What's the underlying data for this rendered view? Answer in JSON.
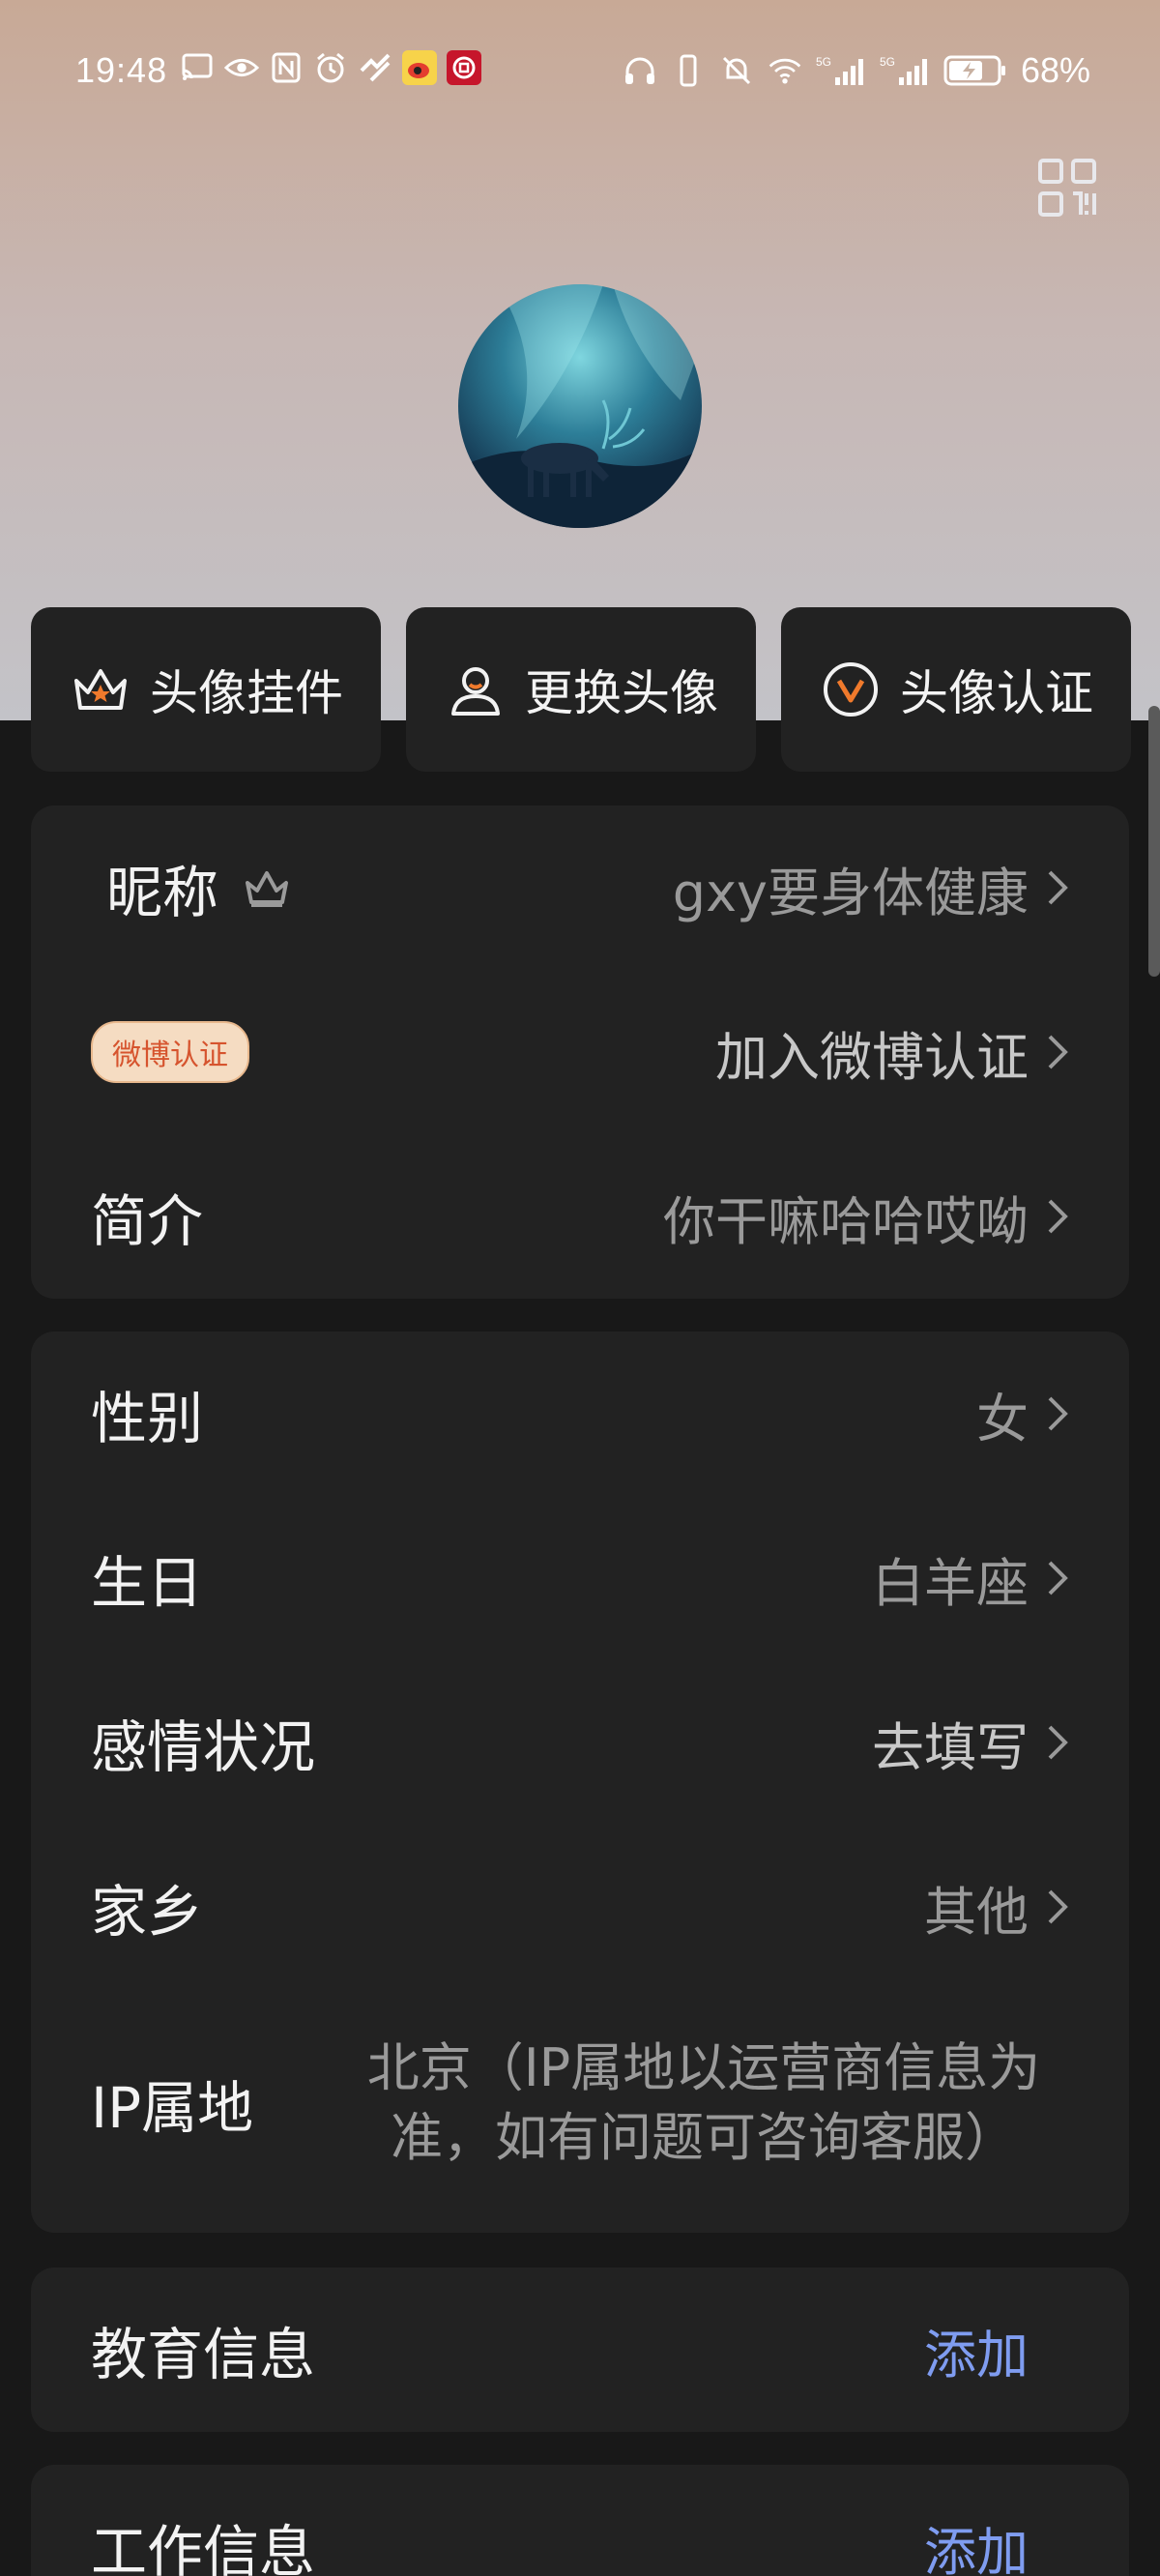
{
  "status_bar": {
    "time": "19:48",
    "battery_percent": "68%",
    "network_labels": [
      "5G",
      "5G"
    ]
  },
  "header": {
    "qr_icon": "qr-code-icon",
    "avatar_alt": "avatar"
  },
  "actions": [
    {
      "label": "头像挂件",
      "icon": "crown-frame-icon"
    },
    {
      "label": "更换头像",
      "icon": "person-icon"
    },
    {
      "label": "头像认证",
      "icon": "verified-v-icon"
    }
  ],
  "profile": {
    "nickname_label": "昵称",
    "nickname_value": "gxy要身体健康",
    "weibo_badge": "微博认证",
    "weibo_value": "加入微博认证",
    "intro_label": "简介",
    "intro_value": "你干嘛哈哈哎呦"
  },
  "details": {
    "gender_label": "性别",
    "gender_value": "女",
    "birthday_label": "生日",
    "birthday_value": "白羊座",
    "relationship_label": "感情状况",
    "relationship_value": "去填写",
    "hometown_label": "家乡",
    "hometown_value": "其他",
    "ip_label": "IP属地",
    "ip_value_line1": "北京（IP属地以运营商信息为",
    "ip_value_line2": "准，如有问题可咨询客服）"
  },
  "education": {
    "label": "教育信息",
    "action": "添加"
  },
  "work": {
    "label": "工作信息",
    "action": "添加"
  },
  "colors": {
    "background": "#181818",
    "card": "#222222",
    "accent": "#7f9cf0",
    "badge_bg": "#f5dcc2",
    "badge_text": "#d6542e"
  }
}
